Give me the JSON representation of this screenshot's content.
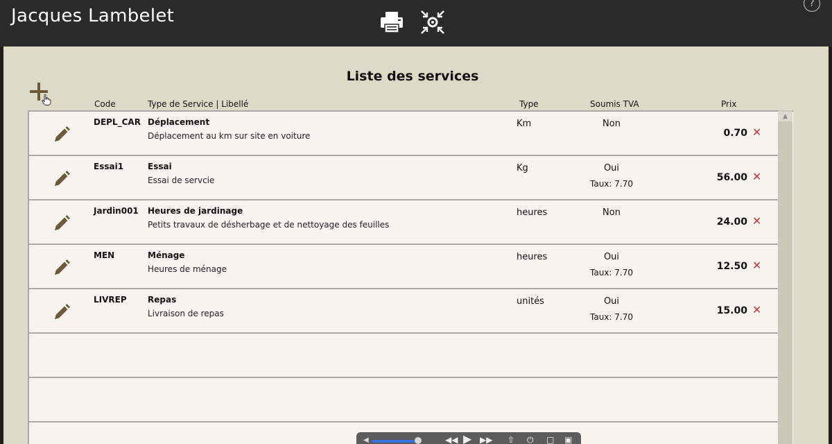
{
  "app": {
    "title": "Jacques Lambelet"
  },
  "toolbar": {
    "print_icon": "printer-icon",
    "fit_icon": "fit-screen-icon",
    "help_label": "?"
  },
  "page": {
    "title": "Liste des services"
  },
  "columns": {
    "code": "Code",
    "type_service": "Type de Service | Libellé",
    "type": "Type",
    "tva": "Soumis TVA",
    "prix": "Prix"
  },
  "rows": [
    {
      "code": "DEPL_CAR",
      "title": "Déplacement",
      "desc": "Déplacement au km sur site en voiture",
      "unit": "Km",
      "tva": "Non",
      "taux": "",
      "price": "0.70"
    },
    {
      "code": "Essai1",
      "title": "Essai",
      "desc": "Essai de servcie",
      "unit": "Kg",
      "tva": "Oui",
      "taux": "Taux: 7.70",
      "price": "56.00"
    },
    {
      "code": "Jardin001",
      "title": "Heures de jardinage",
      "desc": "Petits travaux de désherbage et de nettoyage des feuilles",
      "unit": "heures",
      "tva": "Non",
      "taux": "",
      "price": "24.00"
    },
    {
      "code": "MEN",
      "title": "Ménage",
      "desc": "Heures de ménage",
      "unit": "heures",
      "tva": "Oui",
      "taux": "Taux: 7.70",
      "price": "12.50"
    },
    {
      "code": "LIVREP",
      "title": "Repas",
      "desc": "Livraison de repas",
      "unit": "unités",
      "tva": "Oui",
      "taux": "Taux: 7.70",
      "price": "15.00"
    }
  ],
  "delete_glyph": "✕",
  "colors": {
    "topbar": "#2a2a2a",
    "background": "#dcdbc8",
    "table": "#f8f5f0",
    "delete": "#d6303a",
    "icon_brown": "#6b5a3a"
  }
}
